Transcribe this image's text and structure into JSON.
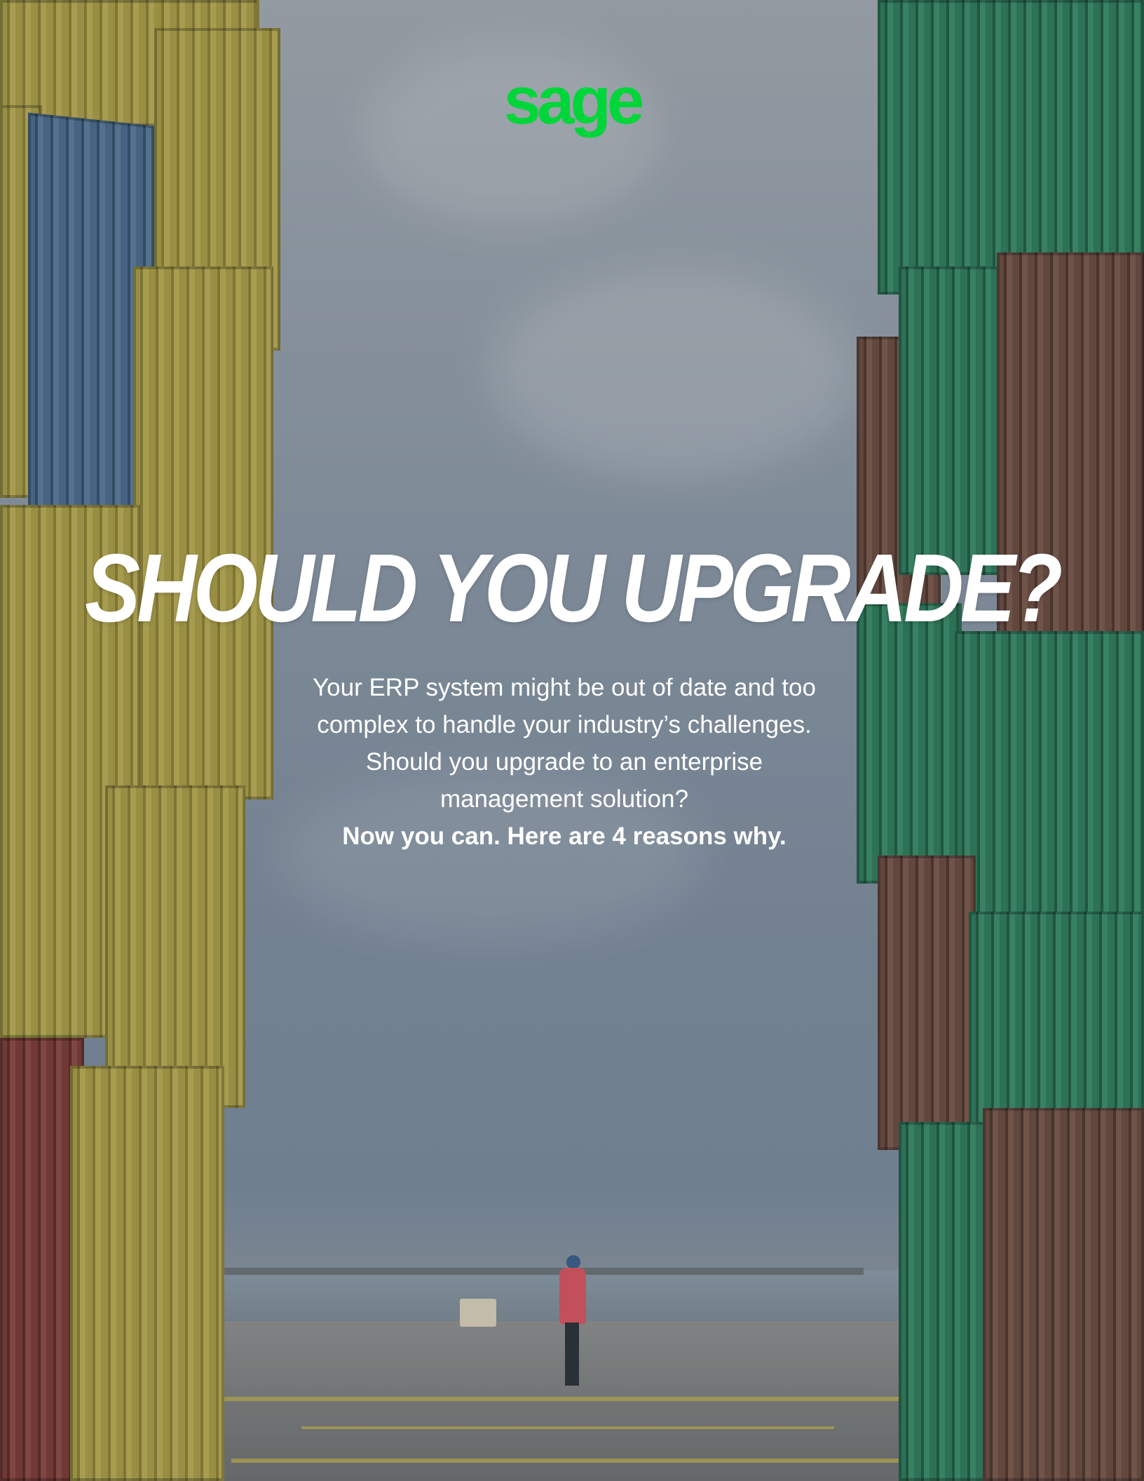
{
  "brand": {
    "logo_text": "sage",
    "accent_color": "#00d639"
  },
  "hero": {
    "headline": "SHOULD YOU UPGRADE?",
    "body_lines": [
      "Your ERP system might be out of date and too",
      "complex to handle your industry’s challenges.",
      "Should you upgrade to an enterprise",
      "management solution?"
    ],
    "cta_line": "Now you can. Here are 4 reasons why."
  }
}
